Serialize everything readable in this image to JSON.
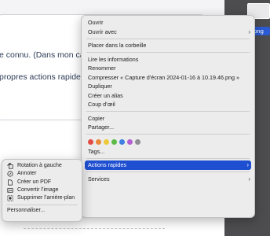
{
  "background": {
    "line1": "e connu. (Dans mon ca",
    "line2": "propres actions rapide",
    "thumbnail_label": "...png"
  },
  "menu": {
    "open": "Ouvrir",
    "open_with": "Ouvrir avec",
    "trash": "Placer dans la corbeille",
    "get_info": "Lire les informations",
    "rename": "Renommer",
    "compress": "Compresser « Capture d’écran 2024-01-16 à 10.19.46.png »",
    "duplicate": "Dupliquer",
    "alias": "Créer un alias",
    "quicklook": "Coup d’œil",
    "copy": "Copier",
    "share": "Partager...",
    "tags": "Tags...",
    "quick_actions": "Actions rapides",
    "services": "Services",
    "tag_colors": [
      "#e34b45",
      "#e88a3a",
      "#ecc83a",
      "#5dbb4a",
      "#3f7fe0",
      "#b45fd1",
      "#8e8e93"
    ]
  },
  "submenu": {
    "rotate": "Rotation à gauche",
    "annotate": "Annoter",
    "create_pdf": "Créer un PDF",
    "convert": "Convertir l’image",
    "remove_bg": "Supprimer l’arrière-plan",
    "customize": "Personnaliser..."
  }
}
